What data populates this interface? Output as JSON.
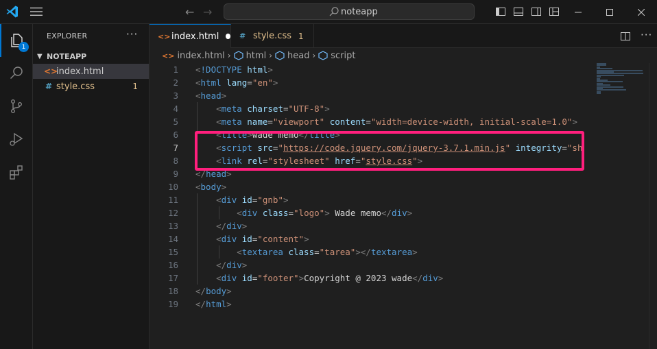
{
  "titlebar": {
    "search_text": "noteapp"
  },
  "activity": {
    "explorer_badge": "1"
  },
  "sidebar": {
    "title": "EXPLORER",
    "more": "···",
    "folder": "NOTEAPP",
    "files": [
      {
        "name": "index.html",
        "icon": "<>",
        "icon_color": "#e37933"
      },
      {
        "name": "style.css",
        "icon": "#",
        "icon_color": "#519aba",
        "problems": "1"
      }
    ]
  },
  "tabs": [
    {
      "label": "index.html",
      "icon": "<>",
      "icon_color": "#e37933",
      "dirty": true
    },
    {
      "label": "style.css",
      "icon": "#",
      "icon_color": "#519aba",
      "problems": "1"
    }
  ],
  "tabbar": {
    "more": "···"
  },
  "breadcrumb": [
    "index.html",
    "html",
    "head",
    "script"
  ],
  "code_lines": [
    {
      "n": "1",
      "tokens": [
        [
          "p",
          "<"
        ],
        [
          "t",
          "!DOCTYPE "
        ],
        [
          "a",
          "html"
        ],
        [
          "p",
          ">"
        ]
      ]
    },
    {
      "n": "2",
      "tokens": [
        [
          "p",
          "<"
        ],
        [
          "t",
          "html "
        ],
        [
          "a",
          "lang"
        ],
        [
          "x",
          "="
        ],
        [
          "s",
          "\"en\""
        ],
        [
          "p",
          ">"
        ]
      ]
    },
    {
      "n": "3",
      "tokens": [
        [
          "p",
          "<"
        ],
        [
          "t",
          "head"
        ],
        [
          "p",
          ">"
        ]
      ]
    },
    {
      "n": "4",
      "tokens": [
        [
          "x",
          "    "
        ],
        [
          "p",
          "<"
        ],
        [
          "t",
          "meta "
        ],
        [
          "a",
          "charset"
        ],
        [
          "x",
          "="
        ],
        [
          "s",
          "\"UTF-8\""
        ],
        [
          "p",
          ">"
        ]
      ]
    },
    {
      "n": "5",
      "tokens": [
        [
          "x",
          "    "
        ],
        [
          "p",
          "<"
        ],
        [
          "t",
          "meta "
        ],
        [
          "a",
          "name"
        ],
        [
          "x",
          "="
        ],
        [
          "s",
          "\"viewport\""
        ],
        [
          "x",
          " "
        ],
        [
          "a",
          "content"
        ],
        [
          "x",
          "="
        ],
        [
          "s",
          "\"width=device-width, initial-scale=1.0\""
        ],
        [
          "p",
          ">"
        ]
      ]
    },
    {
      "n": "6",
      "tokens": [
        [
          "x",
          "    "
        ],
        [
          "p",
          "<"
        ],
        [
          "t",
          "title"
        ],
        [
          "p",
          ">"
        ],
        [
          "x",
          "wade memo"
        ],
        [
          "p",
          "</"
        ],
        [
          "t",
          "title"
        ],
        [
          "p",
          ">"
        ]
      ]
    },
    {
      "n": "7",
      "tokens": [
        [
          "x",
          "    "
        ],
        [
          "p",
          "<"
        ],
        [
          "t",
          "script "
        ],
        [
          "a",
          "src"
        ],
        [
          "x",
          "="
        ],
        [
          "s",
          "\""
        ],
        [
          "l",
          "https://code.jquery.com/jquery-3.7.1.min.js"
        ],
        [
          "s",
          "\""
        ],
        [
          "x",
          " "
        ],
        [
          "a",
          "integrity"
        ],
        [
          "x",
          "="
        ],
        [
          "s",
          "\"sh"
        ]
      ]
    },
    {
      "n": "8",
      "tokens": [
        [
          "x",
          "    "
        ],
        [
          "p",
          "<"
        ],
        [
          "t",
          "link "
        ],
        [
          "a",
          "rel"
        ],
        [
          "x",
          "="
        ],
        [
          "s",
          "\"stylesheet\""
        ],
        [
          "x",
          " "
        ],
        [
          "a",
          "href"
        ],
        [
          "x",
          "="
        ],
        [
          "s",
          "\""
        ],
        [
          "l",
          "style.css"
        ],
        [
          "s",
          "\""
        ],
        [
          "p",
          ">"
        ]
      ]
    },
    {
      "n": "9",
      "tokens": [
        [
          "p",
          "</"
        ],
        [
          "t",
          "head"
        ],
        [
          "p",
          ">"
        ]
      ]
    },
    {
      "n": "10",
      "tokens": [
        [
          "p",
          "<"
        ],
        [
          "t",
          "body"
        ],
        [
          "p",
          ">"
        ]
      ]
    },
    {
      "n": "11",
      "tokens": [
        [
          "x",
          "    "
        ],
        [
          "p",
          "<"
        ],
        [
          "t",
          "div "
        ],
        [
          "a",
          "id"
        ],
        [
          "x",
          "="
        ],
        [
          "s",
          "\"gnb\""
        ],
        [
          "p",
          ">"
        ]
      ]
    },
    {
      "n": "12",
      "tokens": [
        [
          "x",
          "        "
        ],
        [
          "p",
          "<"
        ],
        [
          "t",
          "div "
        ],
        [
          "a",
          "class"
        ],
        [
          "x",
          "="
        ],
        [
          "s",
          "\"logo\""
        ],
        [
          "p",
          ">"
        ],
        [
          "x",
          " Wade memo"
        ],
        [
          "p",
          "</"
        ],
        [
          "t",
          "div"
        ],
        [
          "p",
          ">"
        ]
      ]
    },
    {
      "n": "13",
      "tokens": [
        [
          "x",
          "    "
        ],
        [
          "p",
          "</"
        ],
        [
          "t",
          "div"
        ],
        [
          "p",
          ">"
        ]
      ]
    },
    {
      "n": "14",
      "tokens": [
        [
          "x",
          "    "
        ],
        [
          "p",
          "<"
        ],
        [
          "t",
          "div "
        ],
        [
          "a",
          "id"
        ],
        [
          "x",
          "="
        ],
        [
          "s",
          "\"content\""
        ],
        [
          "p",
          ">"
        ]
      ]
    },
    {
      "n": "15",
      "tokens": [
        [
          "x",
          "        "
        ],
        [
          "p",
          "<"
        ],
        [
          "t",
          "textarea "
        ],
        [
          "a",
          "class"
        ],
        [
          "x",
          "="
        ],
        [
          "s",
          "\"tarea\""
        ],
        [
          "p",
          ">"
        ],
        [
          "p",
          "</"
        ],
        [
          "t",
          "textarea"
        ],
        [
          "p",
          ">"
        ]
      ]
    },
    {
      "n": "16",
      "tokens": [
        [
          "x",
          "    "
        ],
        [
          "p",
          "</"
        ],
        [
          "t",
          "div"
        ],
        [
          "p",
          ">"
        ]
      ]
    },
    {
      "n": "17",
      "tokens": [
        [
          "x",
          "    "
        ],
        [
          "p",
          "<"
        ],
        [
          "t",
          "div "
        ],
        [
          "a",
          "id"
        ],
        [
          "x",
          "="
        ],
        [
          "s",
          "\"footer\""
        ],
        [
          "p",
          ">"
        ],
        [
          "x",
          "Copyright @ 2023 wade"
        ],
        [
          "p",
          "</"
        ],
        [
          "t",
          "div"
        ],
        [
          "p",
          ">"
        ]
      ]
    },
    {
      "n": "18",
      "tokens": [
        [
          "p",
          "</"
        ],
        [
          "t",
          "body"
        ],
        [
          "p",
          ">"
        ]
      ]
    },
    {
      "n": "19",
      "tokens": [
        [
          "p",
          "</"
        ],
        [
          "t",
          "html"
        ],
        [
          "p",
          ">"
        ]
      ]
    }
  ],
  "current_line": "7",
  "highlight_color": "#ff1f7d"
}
